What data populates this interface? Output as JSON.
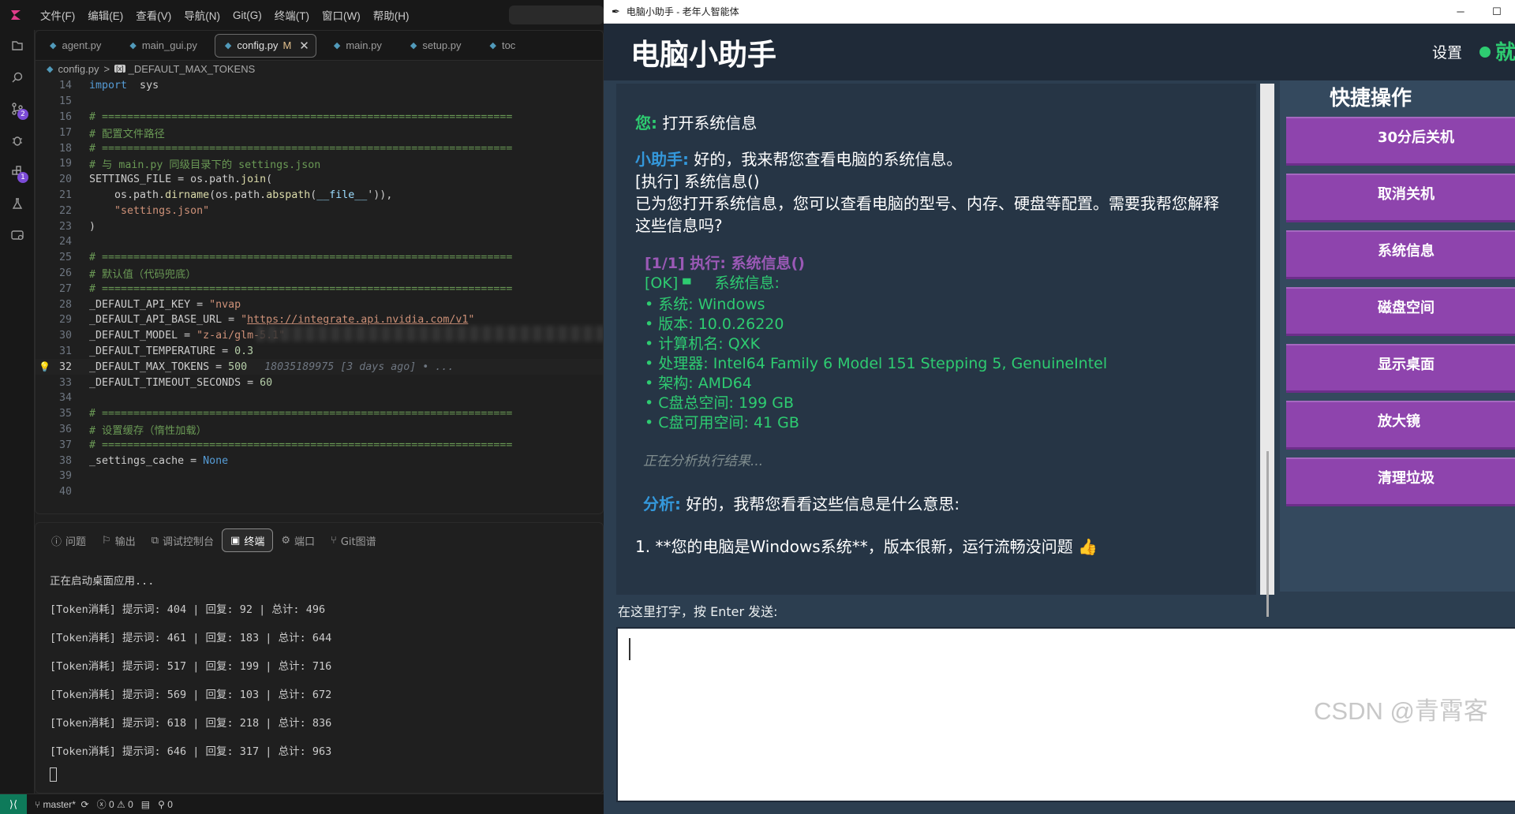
{
  "ide": {
    "menu": [
      "文件(F)",
      "编辑(E)",
      "查看(V)",
      "导航(N)",
      "Git(G)",
      "终端(T)",
      "窗口(W)",
      "帮助(H)"
    ],
    "activity_badges": [
      "2",
      "1"
    ],
    "tabs": [
      {
        "label": "agent.py"
      },
      {
        "label": "main_gui.py"
      },
      {
        "label": "config.py",
        "modified": "M",
        "active": true
      },
      {
        "label": "main.py"
      },
      {
        "label": "setup.py"
      },
      {
        "label": "toc"
      }
    ],
    "breadcrumb": {
      "file": "config.py",
      "sep": ">",
      "symbol": "_DEFAULT_MAX_TOKENS"
    },
    "code_lines": [
      {
        "n": "14",
        "parts": [
          [
            "kw",
            "import"
          ],
          [
            "",
            "  sys"
          ]
        ]
      },
      {
        "n": "15",
        "parts": []
      },
      {
        "n": "16",
        "parts": [
          [
            "cm",
            "# ================================================================="
          ]
        ]
      },
      {
        "n": "17",
        "parts": [
          [
            "cm",
            "# 配置文件路径"
          ]
        ]
      },
      {
        "n": "18",
        "parts": [
          [
            "cm",
            "# ================================================================="
          ]
        ]
      },
      {
        "n": "19",
        "parts": [
          [
            "cm",
            "# 与 main.py 同级目录下的 settings.json"
          ]
        ]
      },
      {
        "n": "20",
        "parts": [
          [
            "",
            "SETTINGS_FILE = os.path."
          ],
          [
            "fn",
            "join"
          ],
          [
            "",
            "("
          ]
        ]
      },
      {
        "n": "21",
        "parts": [
          [
            "",
            "    os.path."
          ],
          [
            "fn",
            "dirname"
          ],
          [
            "",
            "(os.path."
          ],
          [
            "fn",
            "abspath"
          ],
          [
            "",
            "("
          ],
          [
            "var",
            "__file__"
          ],
          [
            "",
            "')),"
          ]
        ]
      },
      {
        "n": "22",
        "parts": [
          [
            "",
            "    "
          ],
          [
            "str",
            "\"settings.json\""
          ]
        ]
      },
      {
        "n": "23",
        "parts": [
          [
            "",
            ")"
          ]
        ]
      },
      {
        "n": "24",
        "parts": []
      },
      {
        "n": "25",
        "parts": [
          [
            "cm",
            "# ================================================================="
          ]
        ]
      },
      {
        "n": "26",
        "parts": [
          [
            "cm",
            "# 默认值（代码兜底）"
          ]
        ]
      },
      {
        "n": "27",
        "parts": [
          [
            "cm",
            "# ================================================================="
          ]
        ]
      },
      {
        "n": "28",
        "parts": [
          [
            "",
            "_DEFAULT_API_KEY = "
          ],
          [
            "str",
            "\"nvap"
          ]
        ]
      },
      {
        "n": "29",
        "parts": [
          [
            "",
            "_DEFAULT_API_BASE_URL = "
          ],
          [
            "str",
            "\""
          ],
          [
            "link",
            "https://integrate.api.nvidia.com/v1"
          ],
          [
            "str",
            "\""
          ]
        ]
      },
      {
        "n": "30",
        "parts": [
          [
            "",
            "_DEFAULT_MODEL = "
          ],
          [
            "str",
            "\"z-ai/glm-5.1\""
          ]
        ]
      },
      {
        "n": "31",
        "parts": [
          [
            "",
            "_DEFAULT_TEMPERATURE = "
          ],
          [
            "num",
            "0.3"
          ]
        ]
      },
      {
        "n": "32",
        "parts": [
          [
            "",
            "_DEFAULT_MAX_TOKENS = "
          ],
          [
            "num",
            "500"
          ],
          [
            "blame",
            "18035189975 [3 days ago] • ..."
          ]
        ],
        "current": true
      },
      {
        "n": "33",
        "parts": [
          [
            "",
            "_DEFAULT_TIMEOUT_SECONDS = "
          ],
          [
            "num",
            "60"
          ]
        ]
      },
      {
        "n": "34",
        "parts": []
      },
      {
        "n": "35",
        "parts": [
          [
            "cm",
            "# ================================================================="
          ]
        ]
      },
      {
        "n": "36",
        "parts": [
          [
            "cm",
            "# 设置缓存（惰性加载）"
          ]
        ]
      },
      {
        "n": "37",
        "parts": [
          [
            "cm",
            "# ================================================================="
          ]
        ]
      },
      {
        "n": "38",
        "parts": [
          [
            "",
            "_settings_cache = "
          ],
          [
            "kw",
            "None"
          ]
        ]
      },
      {
        "n": "39",
        "parts": []
      },
      {
        "n": "40",
        "parts": []
      }
    ],
    "panel_tabs": [
      "问题",
      "输出",
      "调试控制台",
      "终端",
      "端口",
      "Git图谱"
    ],
    "panel_active": "终端",
    "terminal_lines": [
      "正在启动桌面应用...",
      "[Token消耗] 提示词: 404 | 回复: 92 | 总计: 496",
      "[Token消耗] 提示词: 461 | 回复: 183 | 总计: 644",
      "[Token消耗] 提示词: 517 | 回复: 199 | 总计: 716",
      "[Token消耗] 提示词: 569 | 回复: 103 | 总计: 672",
      "[Token消耗] 提示词: 618 | 回复: 218 | 总计: 836",
      "[Token消耗] 提示词: 646 | 回复: 317 | 总计: 963"
    ],
    "status": {
      "branch": "master*",
      "errors": "0",
      "warnings": "0",
      "ports": "0"
    }
  },
  "app": {
    "window_title": "电脑小助手 - 老年人智能体",
    "header_title": "电脑小助手",
    "settings_label": "设置",
    "status_text": "就",
    "status_color": "#2ecc71",
    "chat": {
      "user_label": "您:",
      "user_text": "打开系统信息",
      "bot_label": "小助手:",
      "bot_line1": "好的，我来帮您查看电脑的系统信息。",
      "bot_line2": "[执行] 系统信息()",
      "bot_line3": "已为您打开系统信息，您可以查看电脑的型号、内存、硬盘等配置。需要我帮您解释这些信息吗?",
      "exec_head": "[1/1] 执行: 系统信息()",
      "exec_ok": "[OK]",
      "exec_title": "系统信息:",
      "exec_items": [
        "• 系统: Windows",
        "• 版本: 10.0.26220",
        "• 计算机名: QXK",
        "• 处理器: Intel64 Family 6 Model 151 Stepping 5, GenuineIntel",
        "• 架构: AMD64",
        "• C盘总空间: 199 GB",
        "• C盘可用空间: 41 GB"
      ],
      "thinking": "正在分析执行结果...",
      "analysis_label": "分析:",
      "analysis_text": "好的，我帮您看看这些信息是什么意思:",
      "list_item1": "1. **您的电脑是Windows系统**，版本很新，运行流畅没问题 👍"
    },
    "quick": {
      "title": "快捷操作",
      "buttons": [
        "30分后关机",
        "取消关机",
        "系统信息",
        "磁盘空间",
        "显示桌面",
        "放大镜",
        "清理垃圾"
      ],
      "color": "#8e44ad"
    },
    "input_label": "在这里打字，按 Enter 发送:",
    "input_value": "",
    "watermark": "CSDN @青霄客"
  }
}
